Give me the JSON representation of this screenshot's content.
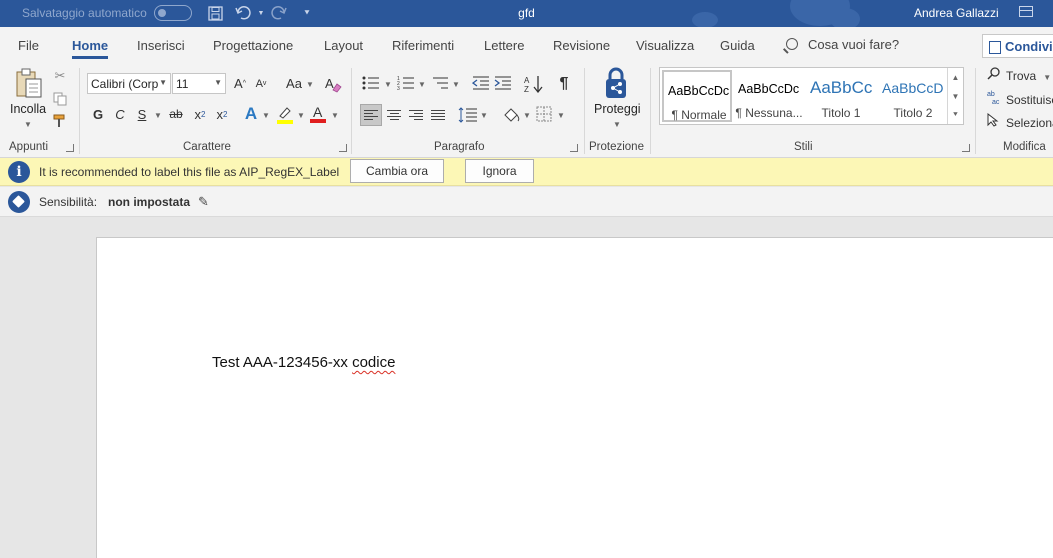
{
  "titlebar": {
    "autosave_label": "Salvataggio automatico",
    "doc_title": "gfd",
    "user_name": "Andrea Gallazzi",
    "bg_color": "#2b579a"
  },
  "tabs": {
    "items": [
      "File",
      "Home",
      "Inserisci",
      "Progettazione",
      "Layout",
      "Riferimenti",
      "Lettere",
      "Revisione",
      "Visualizza",
      "Guida"
    ],
    "active": "Home",
    "tell_me": "Cosa vuoi fare?",
    "share": "Condividi"
  },
  "ribbon": {
    "clipboard": {
      "paste_label": "Incolla",
      "group_label": "Appunti"
    },
    "font": {
      "font_name": "Calibri (Corp",
      "font_size": "11",
      "bold": "G",
      "italic": "C",
      "underline": "S",
      "strike": "ab",
      "subscript": "x",
      "superscript": "x",
      "grow": "A",
      "shrink": "A",
      "case": "Aa",
      "text_effects": "A",
      "font_color": "A",
      "group_label": "Carattere"
    },
    "paragraph": {
      "group_label": "Paragrafo",
      "pilcrow": "¶"
    },
    "protection": {
      "protect_label": "Proteggi",
      "group_label": "Protezione"
    },
    "styles": {
      "group_label": "Stili",
      "items": [
        {
          "preview": "AaBbCcDc",
          "name": "¶ Normale"
        },
        {
          "preview": "AaBbCcDc",
          "name": "¶ Nessuna..."
        },
        {
          "preview": "AaBbCc",
          "name": "Titolo 1"
        },
        {
          "preview": "AaBbCcD",
          "name": "Titolo 2"
        }
      ]
    },
    "editing": {
      "group_label": "Modifica",
      "find": "Trova",
      "replace": "Sostituisci",
      "select": "Seleziona"
    }
  },
  "infobar": {
    "message": "It is recommended to label this file as AIP_RegEX_Label",
    "change_now": "Cambia ora",
    "ignore": "Ignora",
    "bg_color": "#fcf7b6"
  },
  "sensitivity": {
    "label": "Sensibilità:",
    "value": "non impostata"
  },
  "document": {
    "text_before": "Test AAA-123456-xx ",
    "misspelled": "codice"
  }
}
